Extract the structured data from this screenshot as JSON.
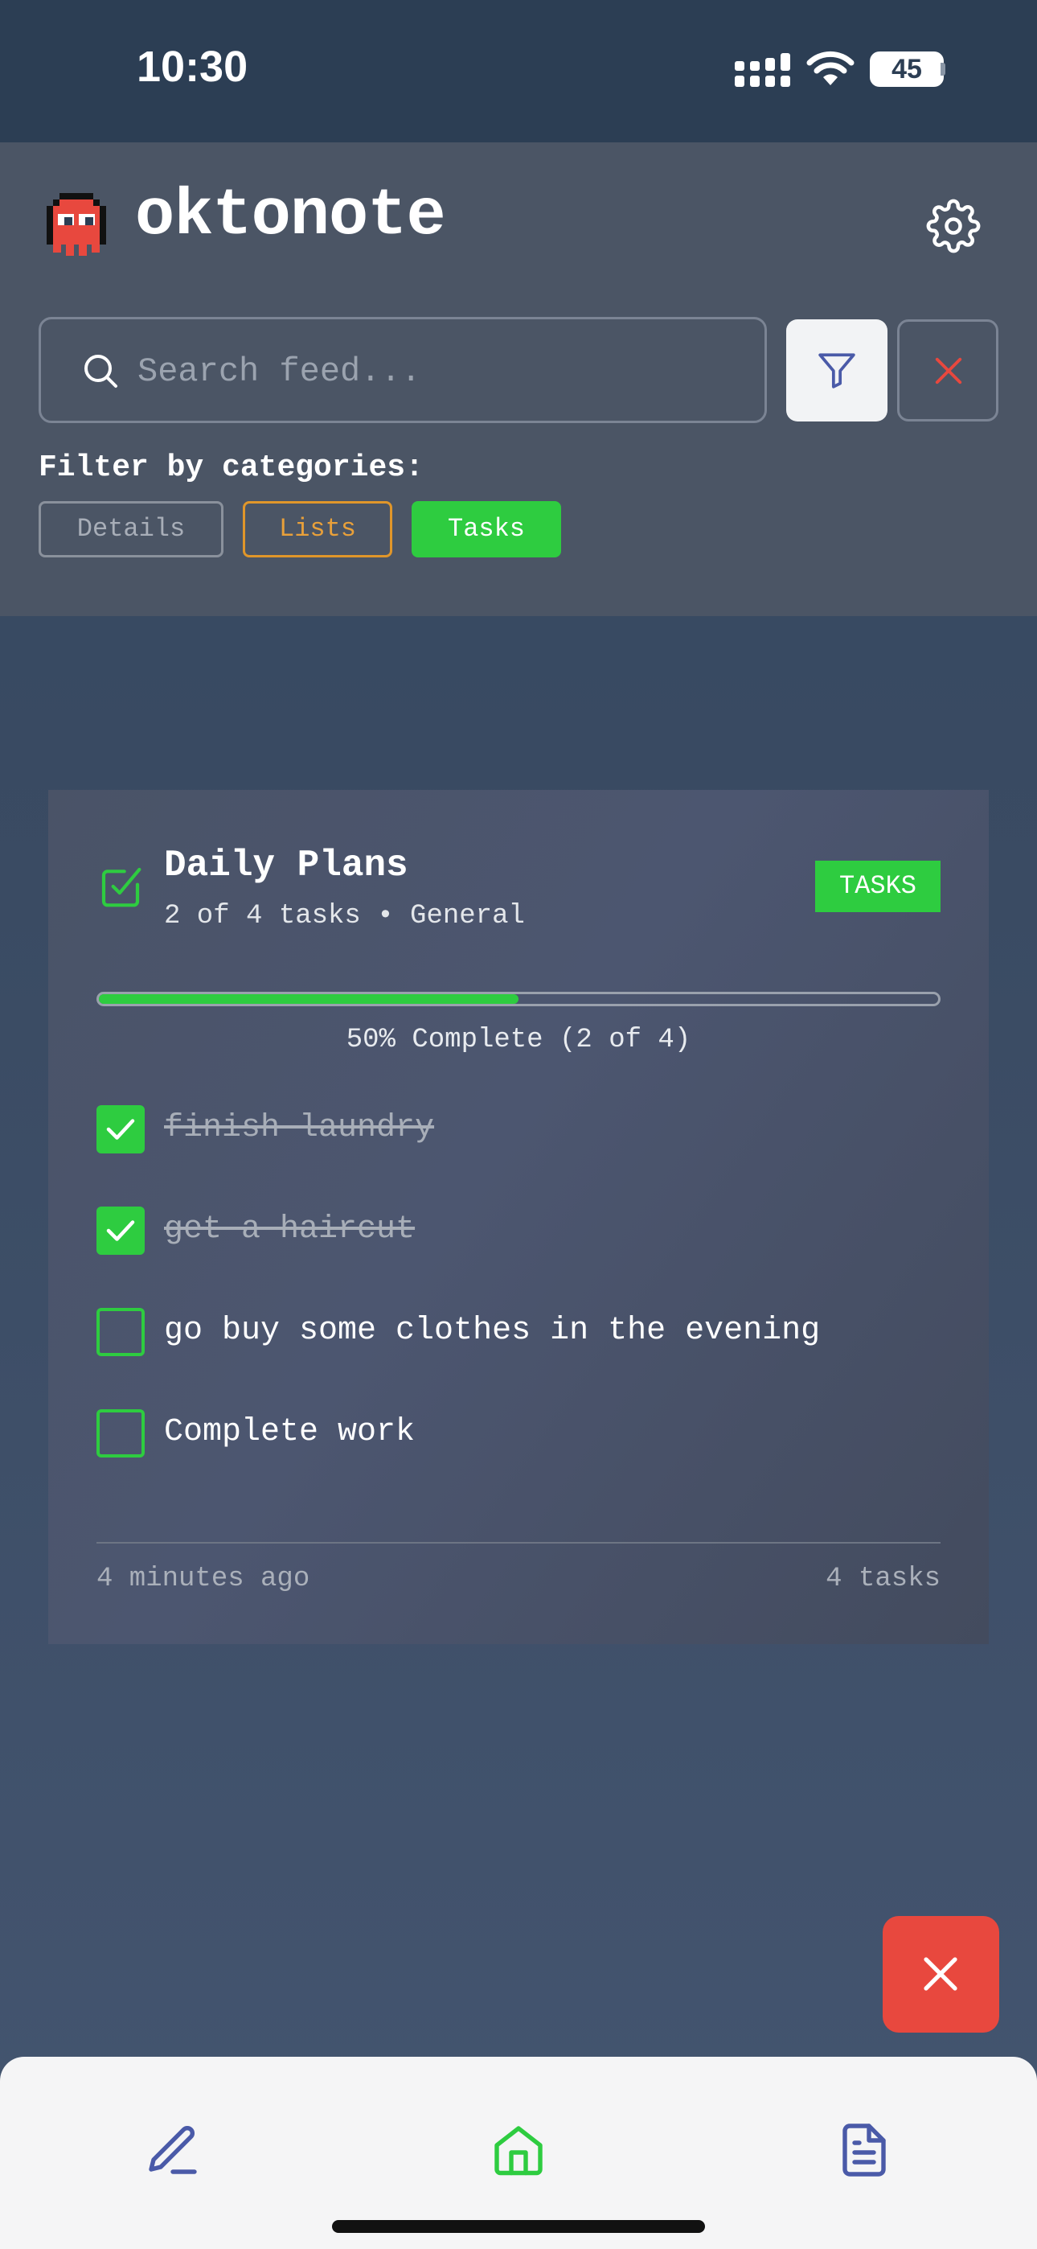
{
  "status_bar": {
    "time": "10:30",
    "battery": "45",
    "icons": [
      "signal-icon",
      "wifi-icon",
      "battery-icon"
    ]
  },
  "header": {
    "app_title": "oktonote",
    "logo_icon": "red-ghost-octopus-icon",
    "settings_icon": "gear-icon"
  },
  "search": {
    "placeholder": "Search feed...",
    "value": "",
    "filter_icon": "funnel-icon",
    "clear_icon": "close-icon"
  },
  "filters": {
    "label": "Filter by categories:",
    "chips": [
      {
        "label": "Details",
        "state": "inactive",
        "color": "#8a919c"
      },
      {
        "label": "Lists",
        "state": "outlined",
        "color": "#e0962a"
      },
      {
        "label": "Tasks",
        "state": "active",
        "color": "#2ecc40"
      }
    ]
  },
  "card": {
    "title": "Daily Plans",
    "subtitle": "2 of 4 tasks • General",
    "badge": "TASKS",
    "progress": {
      "completed": 2,
      "total": 4,
      "fraction": 0.5
    },
    "progress_text": "50% Complete (2 of 4)",
    "tasks": [
      {
        "label": "finish laundry",
        "done": true
      },
      {
        "label": "get a haircut",
        "done": true
      },
      {
        "label": "go buy some clothes in the evening",
        "done": false
      },
      {
        "label": "Complete work",
        "done": false
      }
    ],
    "timestamp": "4 minutes ago",
    "count": "4 tasks"
  },
  "fab": {
    "icon": "close-icon",
    "color": "#e8483e"
  },
  "bottom_nav": {
    "items": [
      {
        "icon": "pencil-icon",
        "name": "write"
      },
      {
        "icon": "home-icon",
        "name": "home",
        "active": true
      },
      {
        "icon": "document-icon",
        "name": "docs"
      }
    ]
  },
  "colors": {
    "accent_green": "#2ecc40",
    "danger_red": "#e8483e",
    "nav_blue": "#4a5aa8",
    "header_bg": "#4b5565"
  }
}
